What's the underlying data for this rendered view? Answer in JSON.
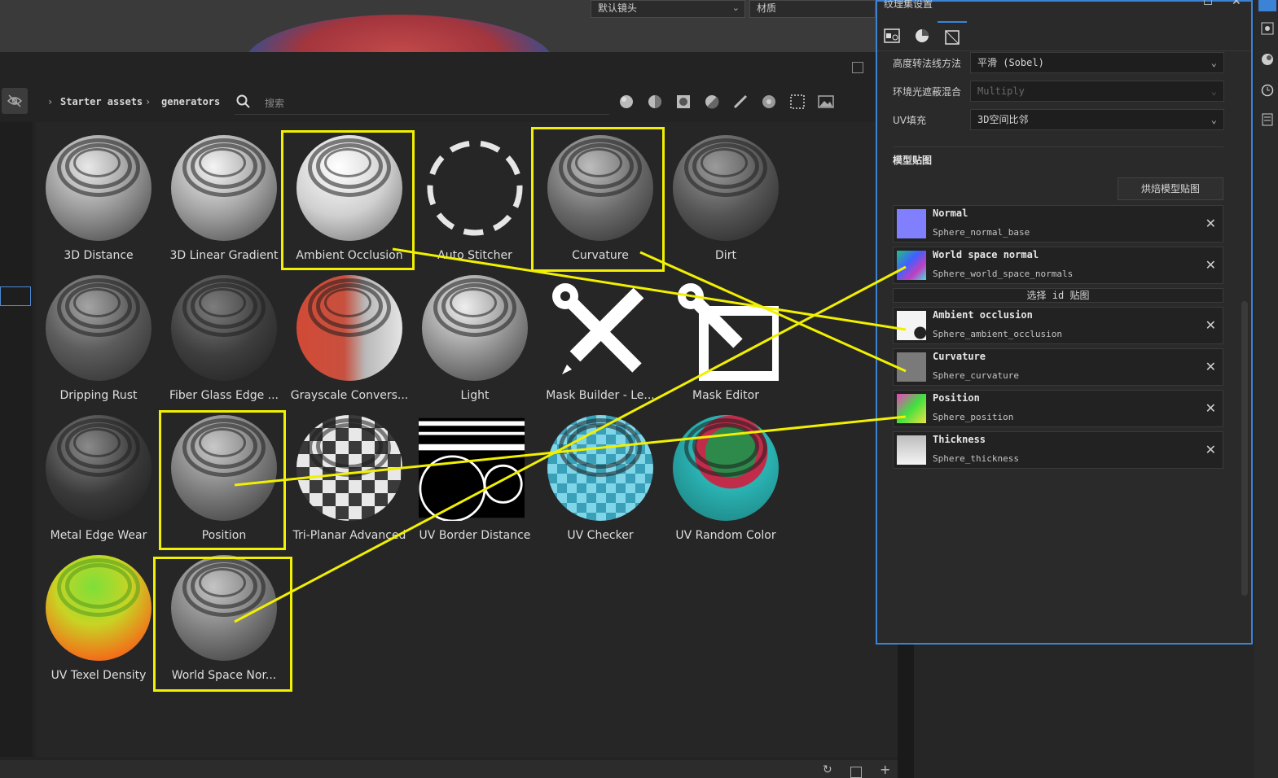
{
  "top": {
    "camera_dropdown": "默认镜头",
    "material_dropdown": "材质"
  },
  "assets": {
    "breadcrumb": [
      "Starter assets",
      "generators"
    ],
    "search_placeholder": "搜索",
    "filter_icons": [
      "sphere-filter-icon",
      "smart-material-icon",
      "material-icon",
      "smart-mask-icon",
      "brush-icon",
      "procedural-icon",
      "texture-grid-icon",
      "environment-icon"
    ],
    "items": [
      {
        "label": "3D Distance"
      },
      {
        "label": "3D Linear Gradient"
      },
      {
        "label": "Ambient Occlusion"
      },
      {
        "label": "Auto Stitcher"
      },
      {
        "label": "Curvature"
      },
      {
        "label": "Dirt"
      },
      {
        "label": "Dripping Rust"
      },
      {
        "label": "Fiber Glass Edge ..."
      },
      {
        "label": "Grayscale Convers..."
      },
      {
        "label": "Light"
      },
      {
        "label": "Mask Builder - Le..."
      },
      {
        "label": "Mask Editor"
      },
      {
        "label": "Metal Edge Wear"
      },
      {
        "label": "Position"
      },
      {
        "label": "Tri-Planar Advanced"
      },
      {
        "label": "UV Border Distance"
      },
      {
        "label": "UV Checker"
      },
      {
        "label": "UV Random Color"
      },
      {
        "label": "UV Texel Density"
      },
      {
        "label": "World Space Nor..."
      }
    ]
  },
  "texture_set": {
    "title": "纹理集设置",
    "tabs": [
      "texture-set-tab-icon",
      "material-tab-icon",
      "mesh-maps-tab-icon"
    ],
    "props": [
      {
        "label": "高度转法线方法",
        "value": "平滑 (Sobel)"
      },
      {
        "label": "环境光遮蔽混合",
        "value": "Multiply"
      },
      {
        "label": "UV填充",
        "value": "3D空间比邻"
      }
    ],
    "mesh_maps_title": "模型贴图",
    "bake_button": "烘焙模型贴图",
    "select_id_map": "选择 id 贴图",
    "maps": [
      {
        "name": "Normal",
        "file": "Sphere_normal_base"
      },
      {
        "name": "World space normal",
        "file": "Sphere_world_space_normals"
      },
      {
        "name": "Ambient occlusion",
        "file": "Sphere_ambient_occlusion"
      },
      {
        "name": "Curvature",
        "file": "Sphere_curvature"
      },
      {
        "name": "Position",
        "file": "Sphere_position"
      },
      {
        "name": "Thickness",
        "file": "Sphere_thickness"
      }
    ]
  },
  "colors": {
    "highlight": "#f1f000",
    "panel_border": "#3c83d6"
  }
}
